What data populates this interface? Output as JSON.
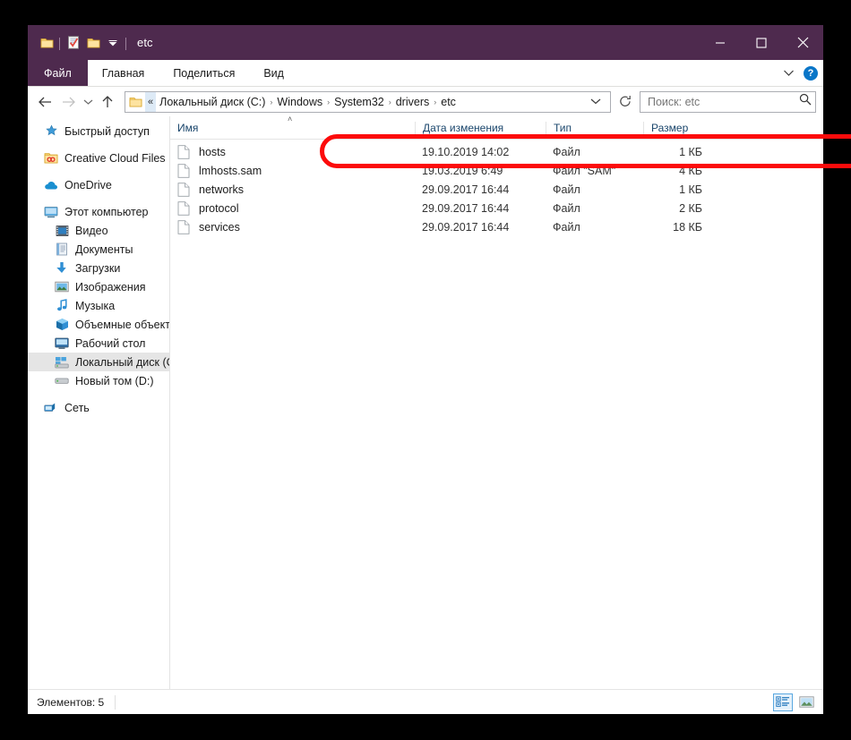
{
  "window": {
    "title": "etc",
    "accent_color": "#4e2a4e",
    "quick_access": [
      {
        "name": "folder-icon",
        "label": ""
      },
      {
        "name": "properties-icon",
        "label": ""
      },
      {
        "name": "new-folder-icon",
        "label": ""
      },
      {
        "name": "chevron-down-icon",
        "label": ""
      }
    ],
    "controls": {
      "minimize": "—",
      "maximize": "☐",
      "close": "✕"
    }
  },
  "ribbon": {
    "tabs": [
      {
        "label": "Файл",
        "active": true
      },
      {
        "label": "Главная",
        "active": false
      },
      {
        "label": "Поделиться",
        "active": false
      },
      {
        "label": "Вид",
        "active": false
      }
    ],
    "expand_icon": "chevron-down-icon",
    "help_label": "?"
  },
  "address": {
    "back_title": "Назад",
    "forward_title": "Вперед",
    "recent_title": "Последние расположения",
    "up_title": "Вверх",
    "overflow": "«",
    "crumbs": [
      "Локальный диск (C:)",
      "Windows",
      "System32",
      "drivers",
      "etc"
    ],
    "separator": "›",
    "dropdown_icon": "chevron-down-icon",
    "refresh_icon": "↻"
  },
  "search": {
    "placeholder": "Поиск: etc",
    "value": "",
    "icon": "search-icon"
  },
  "sidebar": {
    "items": [
      {
        "label": "Быстрый доступ",
        "icon": "star-icon",
        "level": 0,
        "gap": false,
        "selected": false
      },
      {
        "label": "Creative Cloud Files",
        "icon": "creative-cloud-folder-icon",
        "level": 0,
        "gap": true,
        "selected": false
      },
      {
        "label": "OneDrive",
        "icon": "cloud-icon",
        "level": 0,
        "gap": true,
        "selected": false
      },
      {
        "label": "Этот компьютер",
        "icon": "computer-icon",
        "level": 0,
        "gap": true,
        "selected": false
      },
      {
        "label": "Видео",
        "icon": "video-icon",
        "level": 1,
        "gap": false,
        "selected": false
      },
      {
        "label": "Документы",
        "icon": "documents-icon",
        "level": 1,
        "gap": false,
        "selected": false
      },
      {
        "label": "Загрузки",
        "icon": "downloads-icon",
        "level": 1,
        "gap": false,
        "selected": false
      },
      {
        "label": "Изображения",
        "icon": "pictures-icon",
        "level": 1,
        "gap": false,
        "selected": false
      },
      {
        "label": "Музыка",
        "icon": "music-icon",
        "level": 1,
        "gap": false,
        "selected": false
      },
      {
        "label": "Объемные объект",
        "icon": "3d-objects-icon",
        "level": 1,
        "gap": false,
        "selected": false
      },
      {
        "label": "Рабочий стол",
        "icon": "desktop-icon",
        "level": 1,
        "gap": false,
        "selected": false
      },
      {
        "label": "Локальный диск (C",
        "icon": "local-disk-icon",
        "level": 1,
        "gap": false,
        "selected": true
      },
      {
        "label": "Новый том (D:)",
        "icon": "drive-icon",
        "level": 1,
        "gap": false,
        "selected": false
      },
      {
        "label": "Сеть",
        "icon": "network-icon",
        "level": 0,
        "gap": true,
        "selected": false
      }
    ]
  },
  "filelist": {
    "columns": [
      {
        "label": "Имя",
        "key": "name",
        "sort": "asc"
      },
      {
        "label": "Дата изменения",
        "key": "date",
        "sort": ""
      },
      {
        "label": "Тип",
        "key": "type",
        "sort": ""
      },
      {
        "label": "Размер",
        "key": "size",
        "sort": ""
      }
    ],
    "sort_caret": "˄",
    "rows": [
      {
        "name": "hosts",
        "date": "19.10.2019 14:02",
        "type": "Файл",
        "size": "1 КБ",
        "icon": "file-icon",
        "highlighted": true
      },
      {
        "name": "lmhosts.sam",
        "date": "19.03.2019 6:49",
        "type": "Файл \"SAM\"",
        "size": "4 КБ",
        "icon": "file-icon",
        "highlighted": false
      },
      {
        "name": "networks",
        "date": "29.09.2017 16:44",
        "type": "Файл",
        "size": "1 КБ",
        "icon": "file-icon",
        "highlighted": false
      },
      {
        "name": "protocol",
        "date": "29.09.2017 16:44",
        "type": "Файл",
        "size": "2 КБ",
        "icon": "file-icon",
        "highlighted": false
      },
      {
        "name": "services",
        "date": "29.09.2017 16:44",
        "type": "Файл",
        "size": "18 КБ",
        "icon": "file-icon",
        "highlighted": false
      }
    ]
  },
  "statusbar": {
    "count_text": "Элементов: 5",
    "views": [
      {
        "name": "details-view-button",
        "active": true
      },
      {
        "name": "large-icons-view-button",
        "active": false
      }
    ]
  },
  "annotation": {
    "color": "#fc0b0b",
    "target_row": "hosts"
  }
}
